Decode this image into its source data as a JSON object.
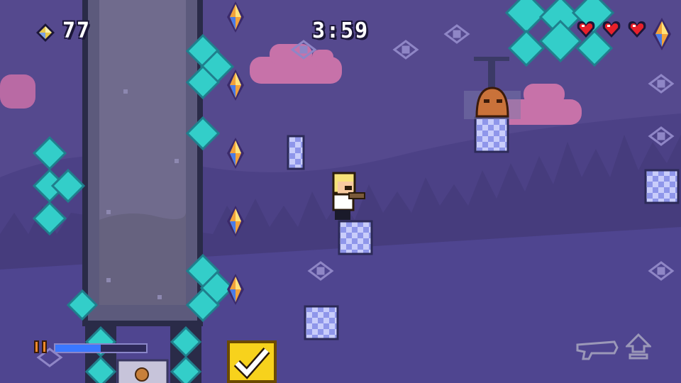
{
  "hud": {
    "gem_count": "77",
    "timer": "3:59",
    "hearts": 3,
    "water_level_fraction": 0.5
  },
  "colors": {
    "sky": "#55498e",
    "hills": "#4a3f82",
    "trees": "#463c7d",
    "cloud": "#c76fa7",
    "crystal": "#31cdc8",
    "tower": "#5a5a7a",
    "ice_block": "#9ea5f2",
    "heart": "#e8202a",
    "confirm_button": "#f7d21c"
  },
  "icons": {
    "gem": "water-sprite-diamond-icon",
    "heart": "heart-icon",
    "pause": "pause-icon",
    "confirm": "checkmark-icon",
    "weapon": "water-cannon-icon",
    "jump": "jump-arrow-icon"
  }
}
